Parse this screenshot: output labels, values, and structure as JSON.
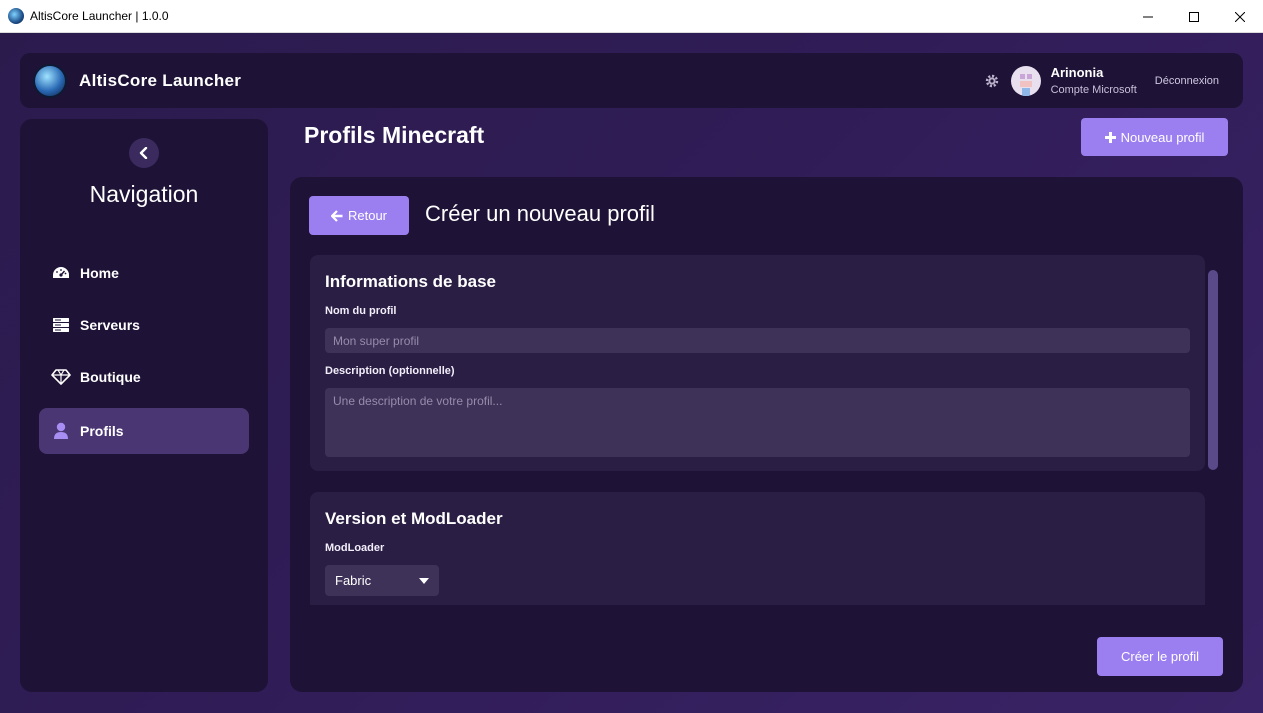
{
  "window": {
    "title": "AltisCore Launcher | 1.0.0"
  },
  "header": {
    "app_name": "AltisCore Launcher",
    "user": {
      "name": "Arinonia",
      "account_type": "Compte Microsoft"
    },
    "logout_label": "Déconnexion"
  },
  "sidebar": {
    "title": "Navigation",
    "items": [
      {
        "label": "Home",
        "icon": "dashboard-icon"
      },
      {
        "label": "Serveurs",
        "icon": "server-icon"
      },
      {
        "label": "Boutique",
        "icon": "diamond-icon"
      },
      {
        "label": "Profils",
        "icon": "user-icon",
        "active": true
      }
    ]
  },
  "page": {
    "title": "Profils Minecraft",
    "new_profile_label": "Nouveau profil"
  },
  "form": {
    "back_label": "Retour",
    "title": "Créer un nouveau profil",
    "basic_section": {
      "title": "Informations de base",
      "name_label": "Nom du profil",
      "name_placeholder": "Mon super profil",
      "description_label": "Description (optionnelle)",
      "description_placeholder": "Une description de votre profil..."
    },
    "version_section": {
      "title": "Version et ModLoader",
      "modloader_label": "ModLoader",
      "modloader_value": "Fabric"
    },
    "submit_label": "Créer le profil"
  },
  "colors": {
    "accent": "#9b7ff0",
    "panel": "#1e1236",
    "card": "#2a1e44",
    "input": "#3f3259"
  }
}
